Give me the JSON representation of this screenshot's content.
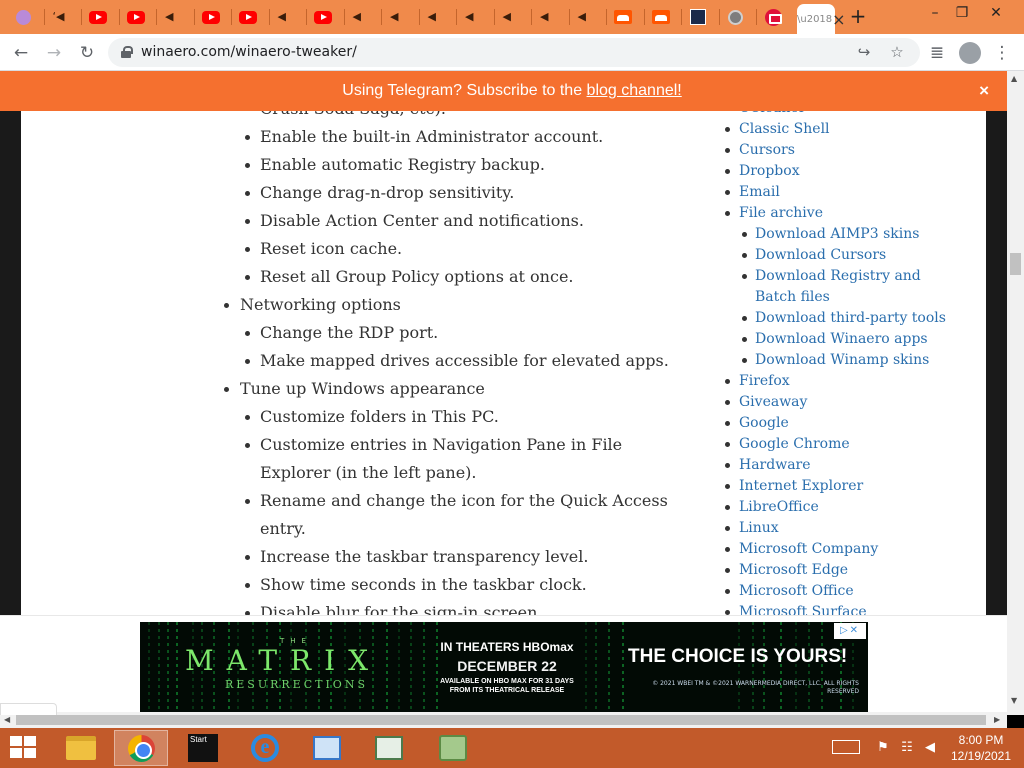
{
  "browser": {
    "tabs": [
      {
        "icon": "purple-circle-icon"
      },
      {
        "icon": "speaker-icon",
        "glyph": "‘◀"
      },
      {
        "icon": "youtube-icon"
      },
      {
        "icon": "youtube-icon"
      },
      {
        "icon": "speaker-icon",
        "glyph": "◀"
      },
      {
        "icon": "youtube-icon"
      },
      {
        "icon": "youtube-icon"
      },
      {
        "icon": "speaker-icon",
        "glyph": "◀"
      },
      {
        "icon": "youtube-icon"
      },
      {
        "icon": "speaker-icon",
        "glyph": "◀"
      },
      {
        "icon": "speaker-icon",
        "glyph": "◀"
      },
      {
        "icon": "speaker-icon",
        "glyph": "◀"
      },
      {
        "icon": "speaker-icon",
        "glyph": "◀"
      },
      {
        "icon": "speaker-icon",
        "glyph": "◀"
      },
      {
        "icon": "speaker-icon",
        "glyph": "◀"
      },
      {
        "icon": "speaker-icon",
        "glyph": "◀"
      },
      {
        "icon": "soundcloud-icon"
      },
      {
        "icon": "soundcloud-icon"
      },
      {
        "icon": "news-icon"
      },
      {
        "icon": "globe-icon"
      },
      {
        "icon": "red-circle-icon"
      }
    ],
    "active_tab_close": "×",
    "new_tab": "+",
    "window_buttons": {
      "minimize": "–",
      "restore": "❐",
      "close": "✕"
    },
    "nav": {
      "back": "←",
      "forward": "→",
      "reload": "↻"
    },
    "url": "winaero.com/winaero-tweaker/",
    "omnibox_icons": {
      "share": "↪",
      "bookmark": "☆",
      "media": "≣",
      "menu": "⋮"
    }
  },
  "banner": {
    "text": "Using Telegram? Subscribe to the ",
    "link": "blog channel!",
    "close": "×",
    "bg_color": "#f5702f"
  },
  "article": {
    "items": [
      {
        "level": 2,
        "text": "Crush Soda Saga, etc).",
        "continuation": true
      },
      {
        "level": 2,
        "text": "Enable the built-in Administrator account."
      },
      {
        "level": 2,
        "text": "Enable automatic Registry backup."
      },
      {
        "level": 2,
        "text": "Change drag-n-drop sensitivity."
      },
      {
        "level": 2,
        "text": "Disable Action Center and notifications."
      },
      {
        "level": 2,
        "text": "Reset icon cache."
      },
      {
        "level": 2,
        "text": "Reset all Group Policy options at once."
      },
      {
        "level": 1,
        "text": "Networking options"
      },
      {
        "level": 2,
        "text": "Change the RDP port."
      },
      {
        "level": 2,
        "text": "Make mapped drives accessible for elevated apps."
      },
      {
        "level": 1,
        "text": "Tune up Windows appearance"
      },
      {
        "level": 2,
        "text": "Customize folders in This PC."
      },
      {
        "level": 2,
        "text": "Customize entries in Navigation Pane in File"
      },
      {
        "level": 2,
        "text": "Explorer (in the left pane).",
        "continuation": true
      },
      {
        "level": 2,
        "text": "Rename and change the icon for the Quick Access"
      },
      {
        "level": 2,
        "text": "entry.",
        "continuation": true
      },
      {
        "level": 2,
        "text": "Increase the taskbar transparency level."
      },
      {
        "level": 2,
        "text": "Show time seconds in the taskbar clock."
      },
      {
        "level": 2,
        "text": "Disable blur for the sign-in screen."
      }
    ]
  },
  "sidebar": {
    "items": [
      {
        "level": 1,
        "text": "CCleaner"
      },
      {
        "level": 1,
        "text": "Classic Shell"
      },
      {
        "level": 1,
        "text": "Cursors"
      },
      {
        "level": 1,
        "text": "Dropbox"
      },
      {
        "level": 1,
        "text": "Email"
      },
      {
        "level": 1,
        "text": "File archive"
      },
      {
        "level": 2,
        "text": "Download AIMP3 skins"
      },
      {
        "level": 2,
        "text": "Download Cursors"
      },
      {
        "level": 2,
        "text": "Download Registry and"
      },
      {
        "level": 2,
        "text": "Batch files",
        "continuation": true
      },
      {
        "level": 2,
        "text": "Download third-party tools"
      },
      {
        "level": 2,
        "text": "Download Winaero apps"
      },
      {
        "level": 2,
        "text": "Download Winamp skins"
      },
      {
        "level": 1,
        "text": "Firefox"
      },
      {
        "level": 1,
        "text": "Giveaway"
      },
      {
        "level": 1,
        "text": "Google"
      },
      {
        "level": 1,
        "text": "Google Chrome"
      },
      {
        "level": 1,
        "text": "Hardware"
      },
      {
        "level": 1,
        "text": "Internet Explorer"
      },
      {
        "level": 1,
        "text": "LibreOffice"
      },
      {
        "level": 1,
        "text": "Linux"
      },
      {
        "level": 1,
        "text": "Microsoft Company"
      },
      {
        "level": 1,
        "text": "Microsoft Edge"
      },
      {
        "level": 1,
        "text": "Microsoft Office"
      },
      {
        "level": 1,
        "text": "Microsoft Surface"
      }
    ],
    "link_color": "#2a6ead"
  },
  "collapse_button": "⌵",
  "ad": {
    "the": "THE",
    "title": "MATRIX",
    "subtitle": "RESURRECTIONS",
    "theaters": "IN THEATERS  HBOmax",
    "date": "DECEMBER 22",
    "availability": "AVAILABLE ON HBO MAX FOR 31 DAYS FROM ITS THEATRICAL RELEASE",
    "choice": "THE CHOICE IS YOURS!",
    "legal": "© 2021 WBEI TM & ©2021 WARNERMEDIA DIRECT, LLC. ALL RIGHTS RESERVED",
    "adchoices": "▷✕"
  },
  "taskbar": {
    "apps": [
      {
        "name": "file-explorer"
      },
      {
        "name": "chrome",
        "active": true
      },
      {
        "name": "start-app",
        "label": "Start"
      },
      {
        "name": "internet-explorer",
        "label": "e"
      },
      {
        "name": "network-app"
      },
      {
        "name": "window-app"
      },
      {
        "name": "download-app"
      }
    ],
    "clock_time": "8:00 PM",
    "clock_date": "12/19/2021",
    "tray": {
      "flag": "⚑",
      "network": "☷",
      "volume": "◀"
    }
  }
}
